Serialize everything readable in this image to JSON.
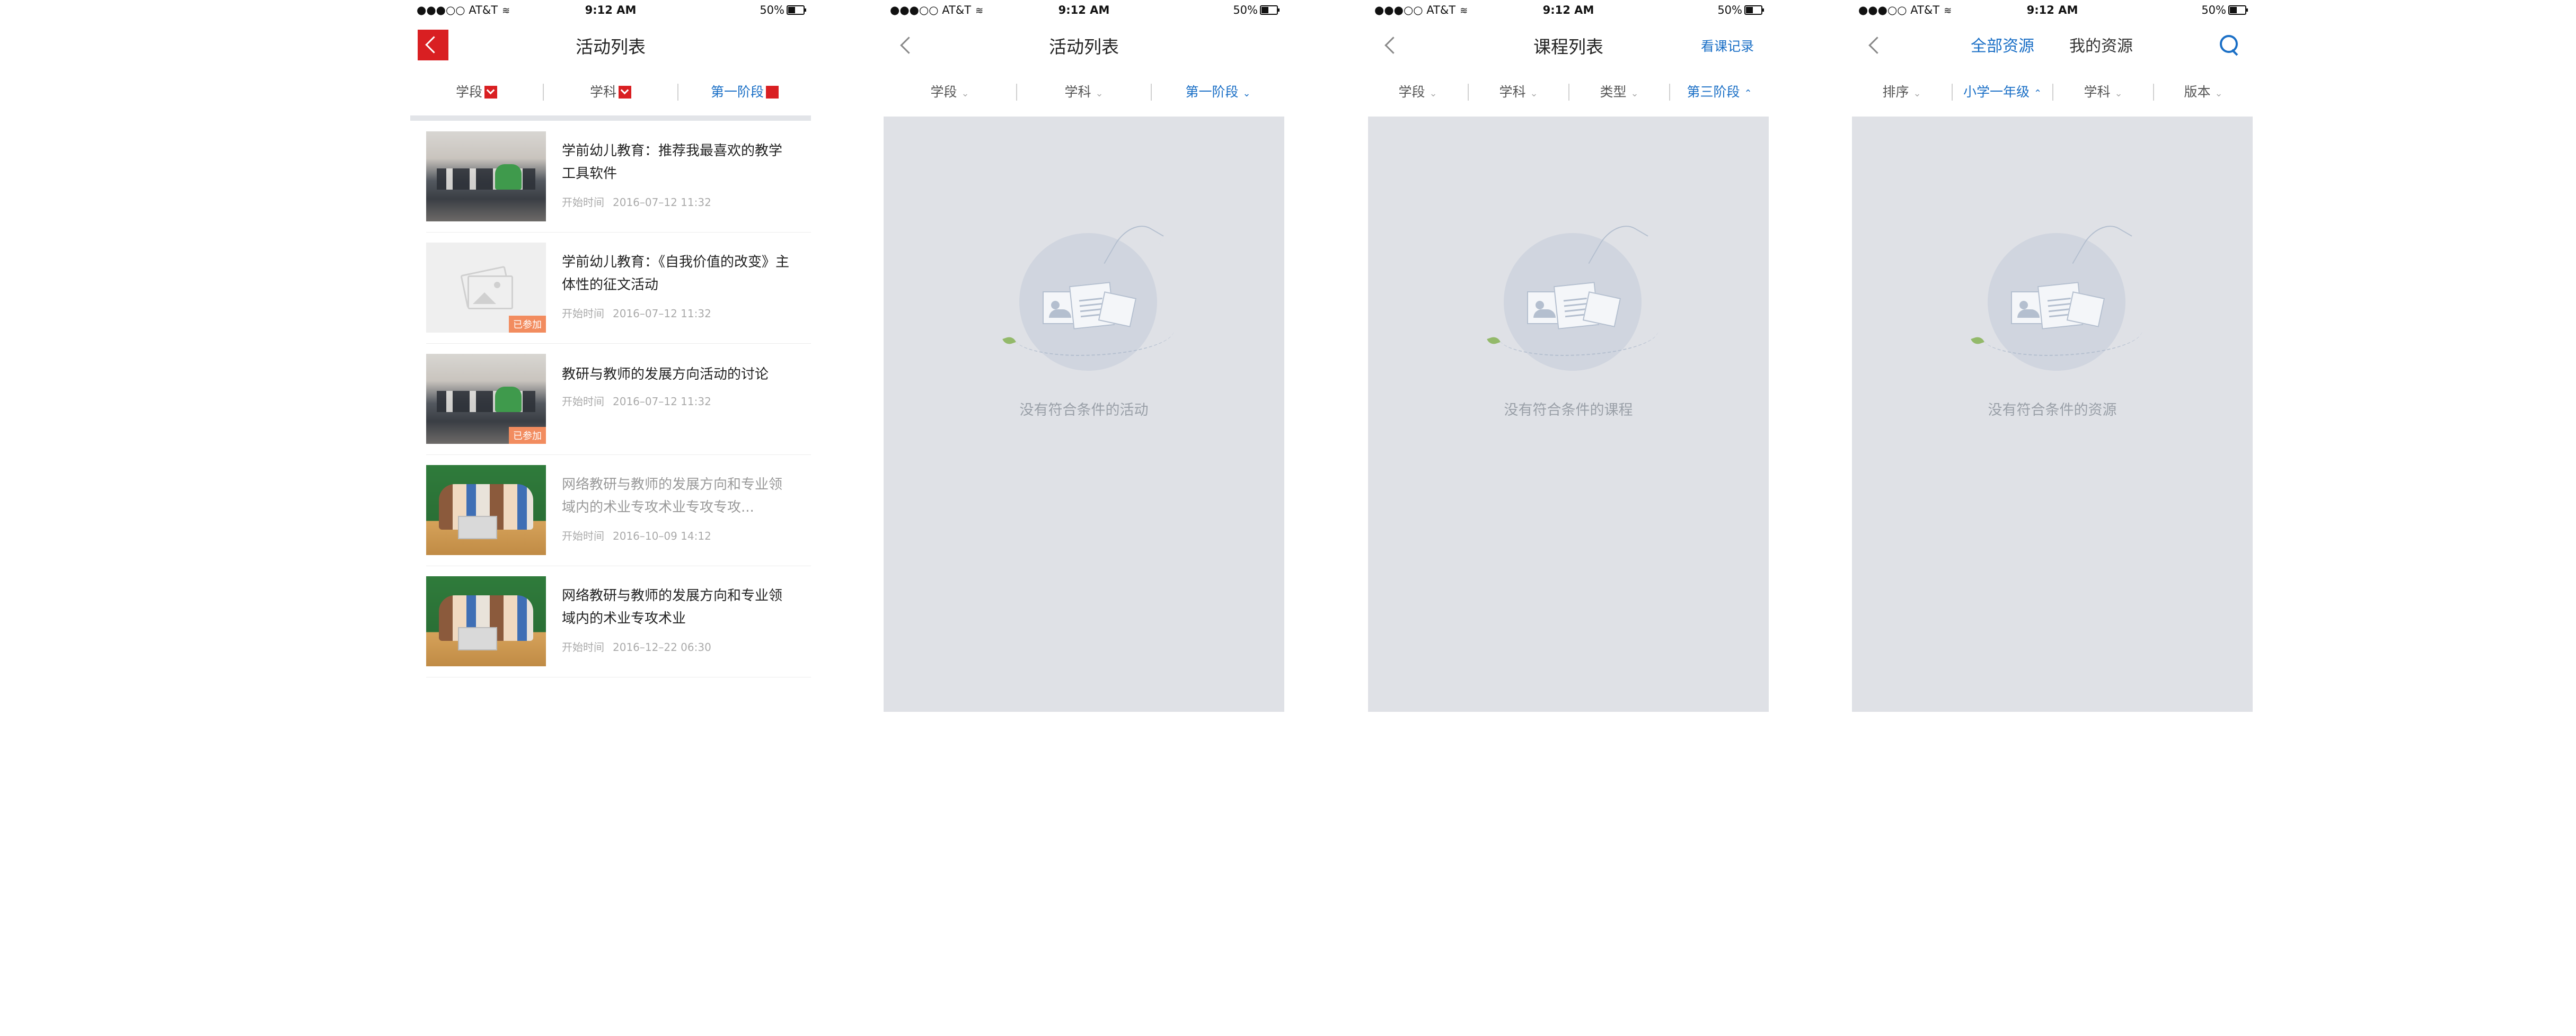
{
  "status": {
    "carrier": "●●●○○ AT&T",
    "time": "9:12 AM",
    "battery": "50%"
  },
  "colors": {
    "accent_red": "#d91f22",
    "accent_blue": "#1a6fc6",
    "empty_bg": "#dfe1e6",
    "joined_badge": "#f28c5f"
  },
  "screen1": {
    "title": "活动列表",
    "filters": [
      "学段",
      "学科",
      "第一阶段"
    ],
    "items": [
      {
        "title": "学前幼儿教育：推荐我最喜欢的教学工具软件",
        "time_label": "开始时间",
        "time": "2016–07–12 11:32",
        "badge": "",
        "thumb": "classroom"
      },
      {
        "title": "学前幼儿教育：《自我价值的改变》主体性的征文活动",
        "time_label": "开始时间",
        "time": "2016–07–12 11:32",
        "badge": "已参加",
        "thumb": "placeholder"
      },
      {
        "title": "教研与教师的发展方向活动的讨论",
        "time_label": "开始时间",
        "time": "2016–07–12 11:32",
        "badge": "已参加",
        "thumb": "classroom"
      },
      {
        "title": "网络教研与教师的发展方向和专业领域内的术业专攻术业专攻专攻...",
        "time_label": "开始时间",
        "time": "2016–10–09 14:12",
        "badge": "",
        "thumb": "blackboard"
      },
      {
        "title": "网络教研与教师的发展方向和专业领域内的术业专攻术业",
        "time_label": "开始时间",
        "time": "2016–12–22 06:30",
        "badge": "",
        "thumb": "blackboard"
      }
    ]
  },
  "screen2": {
    "title": "活动列表",
    "filters": [
      "学段",
      "学科",
      "第一阶段"
    ],
    "empty_text": "没有符合条件的活动"
  },
  "screen3": {
    "title": "课程列表",
    "right_link": "看课记录",
    "filters": [
      "学段",
      "学科",
      "类型",
      "第三阶段"
    ],
    "empty_text": "没有符合条件的课程"
  },
  "screen4": {
    "tabs": [
      "全部资源",
      "我的资源"
    ],
    "filters": [
      "排序",
      "小学一年级",
      "学科",
      "版本"
    ],
    "empty_text": "没有符合条件的资源"
  }
}
